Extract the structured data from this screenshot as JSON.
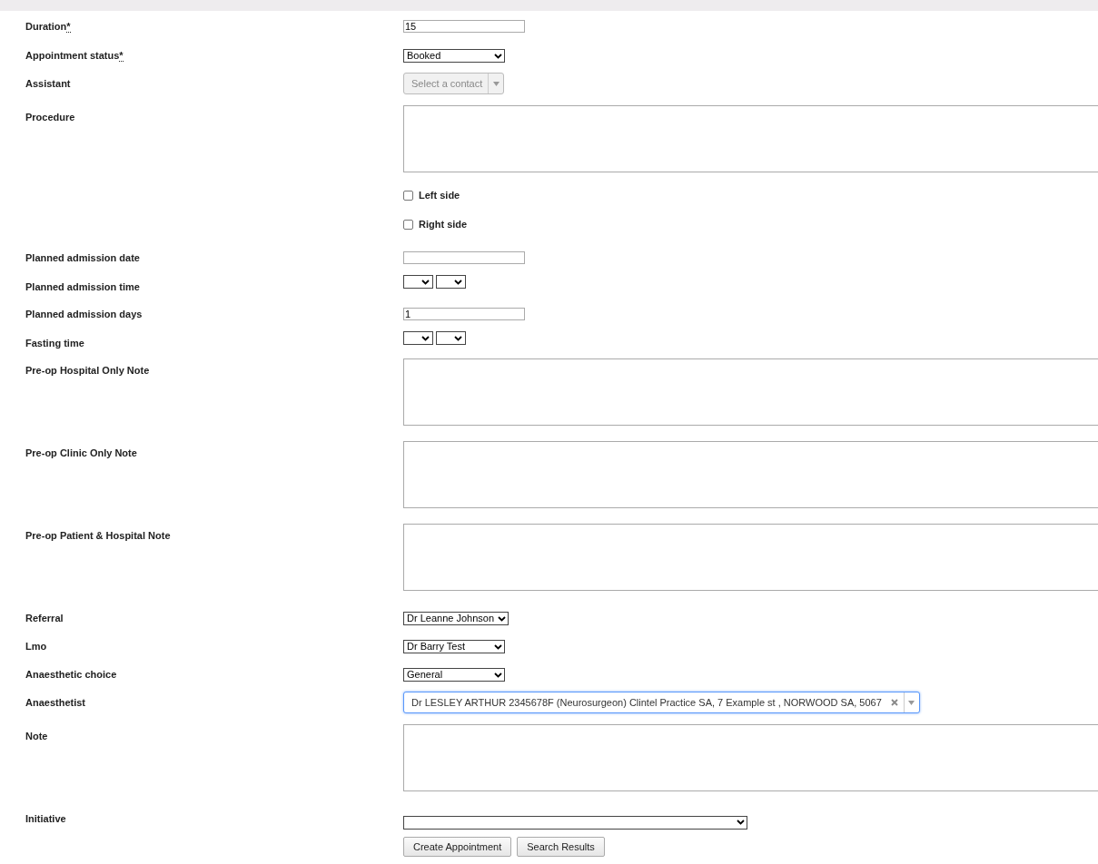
{
  "form": {
    "rows": [
      {
        "kind": "text",
        "label": "Duration",
        "mark": "*",
        "value": "15"
      },
      {
        "kind": "select",
        "label": "Appointment status",
        "mark": "*",
        "value": "Booked"
      },
      {
        "kind": "combo",
        "label": "Assistant",
        "placeholder": "Select a contact",
        "focused": false
      },
      {
        "kind": "textarea",
        "label": "Procedure"
      },
      {
        "kind": "checkbox",
        "label": "Left side",
        "checked": false
      },
      {
        "kind": "checkbox",
        "label": "Right side",
        "checked": false
      },
      {
        "kind": "text",
        "label": "Planned admission date",
        "value": ""
      },
      {
        "kind": "time",
        "label": "Planned admission time"
      },
      {
        "kind": "text",
        "label": "Planned admission days",
        "value": "1"
      },
      {
        "kind": "time",
        "label": "Fasting time"
      },
      {
        "kind": "textarea",
        "label": "Pre-op Hospital Only Note"
      },
      {
        "kind": "textarea",
        "label": "Pre-op Clinic Only Note"
      },
      {
        "kind": "textarea",
        "label": "Pre-op Patient & Hospital Note"
      },
      {
        "kind": "select",
        "label": "Referral",
        "value": "Dr Leanne Johnson"
      },
      {
        "kind": "select",
        "label": "Lmo",
        "value": "Dr Barry Test"
      },
      {
        "kind": "select",
        "label": "Anaesthetic choice",
        "value": "General"
      },
      {
        "kind": "combo",
        "label": "Anaesthetist",
        "value": "Dr LESLEY ARTHUR 2345678F (Neurosurgeon) Clintel Practice SA, 7 Example st , NORWOOD SA, 5067",
        "focused": true
      },
      {
        "kind": "textarea",
        "label": "Note"
      },
      {
        "kind": "select",
        "label": "Initiative",
        "value": ""
      }
    ]
  },
  "buttons": [
    "Create Appointment",
    "Search Results"
  ]
}
